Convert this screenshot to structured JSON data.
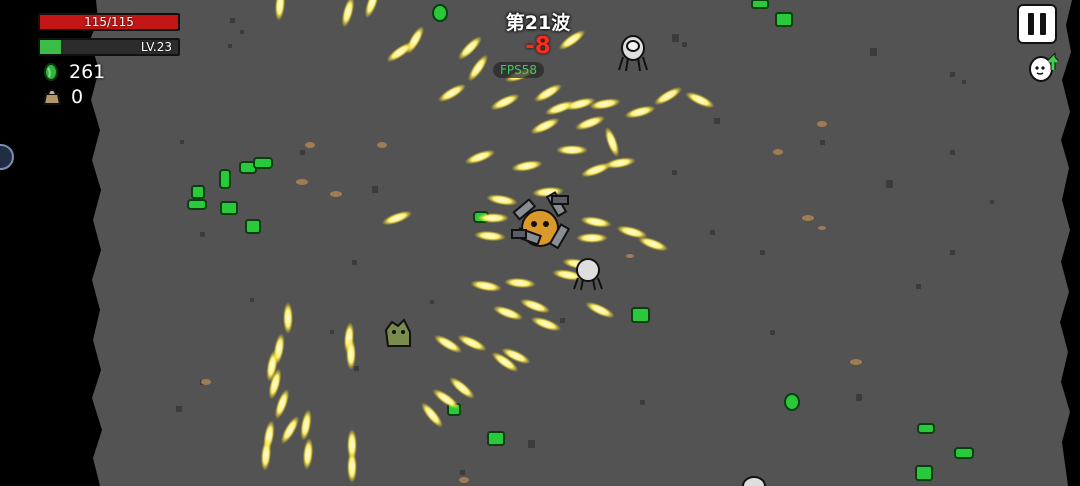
{
  "hud": {
    "health": {
      "text": "115/115",
      "current": 115,
      "max": 115
    },
    "level": {
      "text": "LV.23",
      "progress": 0.15
    },
    "materials": "261",
    "bag": "0",
    "wave": "第21波",
    "damage_popup": "-8",
    "fps": "FPS58"
  },
  "colors": {
    "health": "#c41616",
    "experience": "#3cbd47",
    "damage": "#ff2a1a",
    "projectile": "#fff27a",
    "material": "#28c93a",
    "floor": "#535353"
  },
  "icons": [
    "green-material-icon",
    "loot-bag-icon",
    "pause-icon",
    "level-up-egg-icon"
  ]
}
